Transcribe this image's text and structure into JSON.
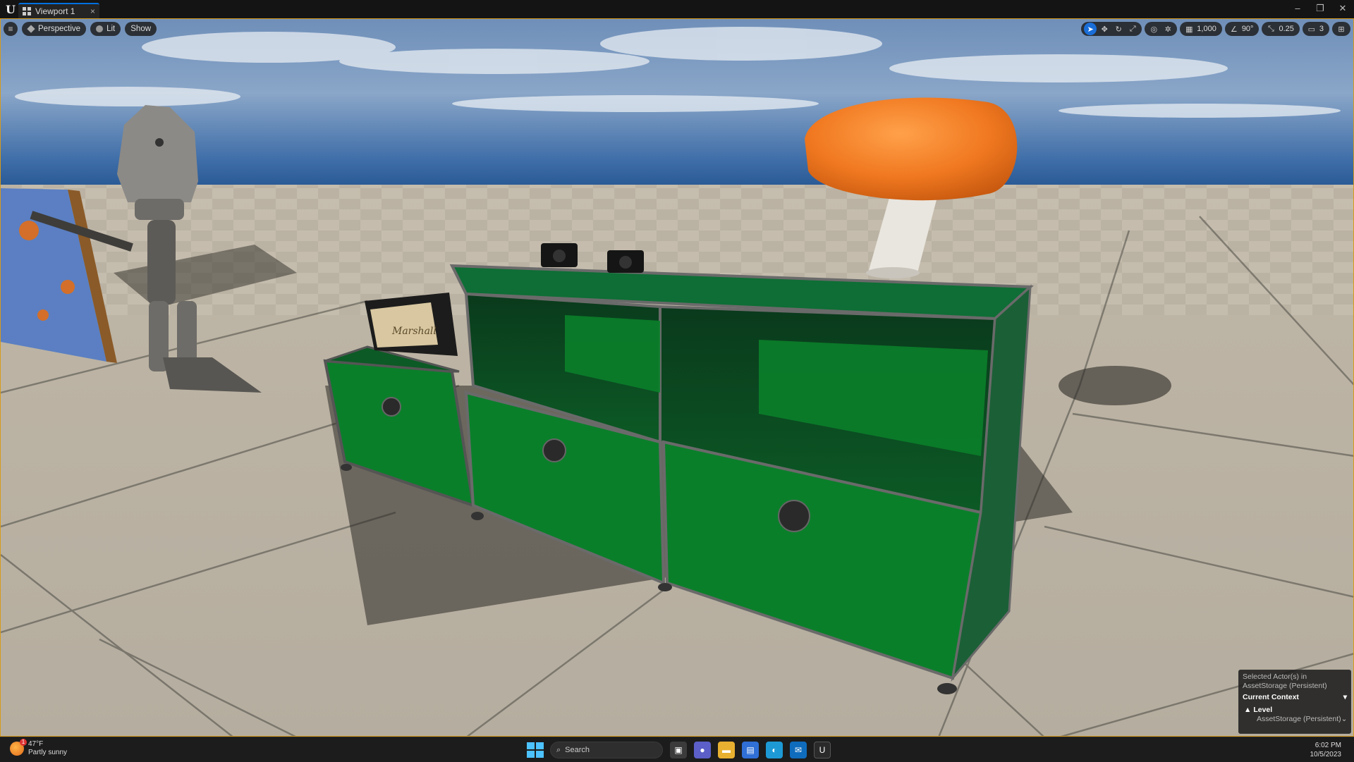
{
  "window": {
    "tab_title": "Viewport 1",
    "tab_close": "×",
    "controls": [
      "–",
      "❐",
      "✕"
    ]
  },
  "viewport_toolbar": {
    "menu_icon": "hamburger-icon",
    "perspective_label": "Perspective",
    "lit_label": "Lit",
    "show_label": "Show"
  },
  "viewport_right_toolbar": {
    "grid_snap_value": "1,000",
    "rotation_snap_value": "90°",
    "scale_snap_value": "0.25",
    "camera_speed_value": "3"
  },
  "context_panel": {
    "line1": "Selected Actor(s) in",
    "line2": "AssetStorage (Persistent)",
    "header": "Current Context",
    "level_label": "Level",
    "level_value": "AssetStorage (Persistent)"
  },
  "taskbar": {
    "weather_temp": "47°F",
    "weather_desc": "Partly sunny",
    "weather_badge": "1",
    "search_placeholder": "Search",
    "time": "6:02 PM",
    "date": "10/5/2023"
  },
  "scene": {
    "radio_brand": "Marshall"
  },
  "colors": {
    "accent": "#1a6ed8",
    "viewport_border": "#d79a1a",
    "cabinet_green": "#0a7f2a",
    "lamp_orange": "#f07820"
  }
}
